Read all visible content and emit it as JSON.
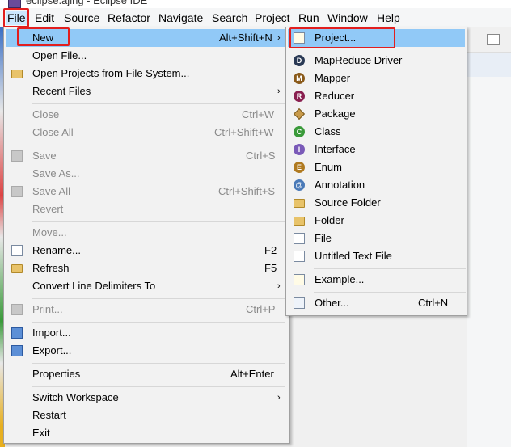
{
  "window": {
    "title": "eclipse.ajing - Eclipse IDE"
  },
  "menubar": {
    "items": [
      "File",
      "Edit",
      "Source",
      "Refactor",
      "Navigate",
      "Search",
      "Project",
      "Run",
      "Window",
      "Help"
    ]
  },
  "file_menu": {
    "new": {
      "label": "New",
      "shortcut": "Alt+Shift+N"
    },
    "open_file": {
      "label": "Open File..."
    },
    "open_projects": {
      "label": "Open Projects from File System..."
    },
    "recent_files": {
      "label": "Recent Files"
    },
    "close": {
      "label": "Close",
      "shortcut": "Ctrl+W"
    },
    "close_all": {
      "label": "Close All",
      "shortcut": "Ctrl+Shift+W"
    },
    "save": {
      "label": "Save",
      "shortcut": "Ctrl+S"
    },
    "save_as": {
      "label": "Save As..."
    },
    "save_all": {
      "label": "Save All",
      "shortcut": "Ctrl+Shift+S"
    },
    "revert": {
      "label": "Revert"
    },
    "move": {
      "label": "Move..."
    },
    "rename": {
      "label": "Rename...",
      "shortcut": "F2"
    },
    "refresh": {
      "label": "Refresh",
      "shortcut": "F5"
    },
    "convert": {
      "label": "Convert Line Delimiters To"
    },
    "print": {
      "label": "Print...",
      "shortcut": "Ctrl+P"
    },
    "import": {
      "label": "Import..."
    },
    "export": {
      "label": "Export..."
    },
    "properties": {
      "label": "Properties",
      "shortcut": "Alt+Enter"
    },
    "switch_workspace": {
      "label": "Switch Workspace"
    },
    "restart": {
      "label": "Restart"
    },
    "exit": {
      "label": "Exit"
    }
  },
  "new_submenu": {
    "project": {
      "label": "Project..."
    },
    "mapreduce_driver": {
      "label": "MapReduce Driver"
    },
    "mapper": {
      "label": "Mapper"
    },
    "reducer": {
      "label": "Reducer"
    },
    "package": {
      "label": "Package"
    },
    "class": {
      "label": "Class"
    },
    "interface": {
      "label": "Interface"
    },
    "enum": {
      "label": "Enum"
    },
    "annotation": {
      "label": "Annotation"
    },
    "source_folder": {
      "label": "Source Folder"
    },
    "folder": {
      "label": "Folder"
    },
    "file": {
      "label": "File"
    },
    "untitled_text_file": {
      "label": "Untitled Text File"
    },
    "example": {
      "label": "Example..."
    },
    "other": {
      "label": "Other...",
      "shortcut": "Ctrl+N"
    }
  },
  "icons": {
    "arrow": "›",
    "mapreduce": "D",
    "mapper": "M",
    "reducer": "R",
    "class": "C",
    "interface": "I",
    "enum": "E",
    "annotation": "@"
  },
  "colors": {
    "selection": "#91c9f7",
    "highlight_box": "#e21e1e",
    "menubar_active": "#cce8ff"
  }
}
